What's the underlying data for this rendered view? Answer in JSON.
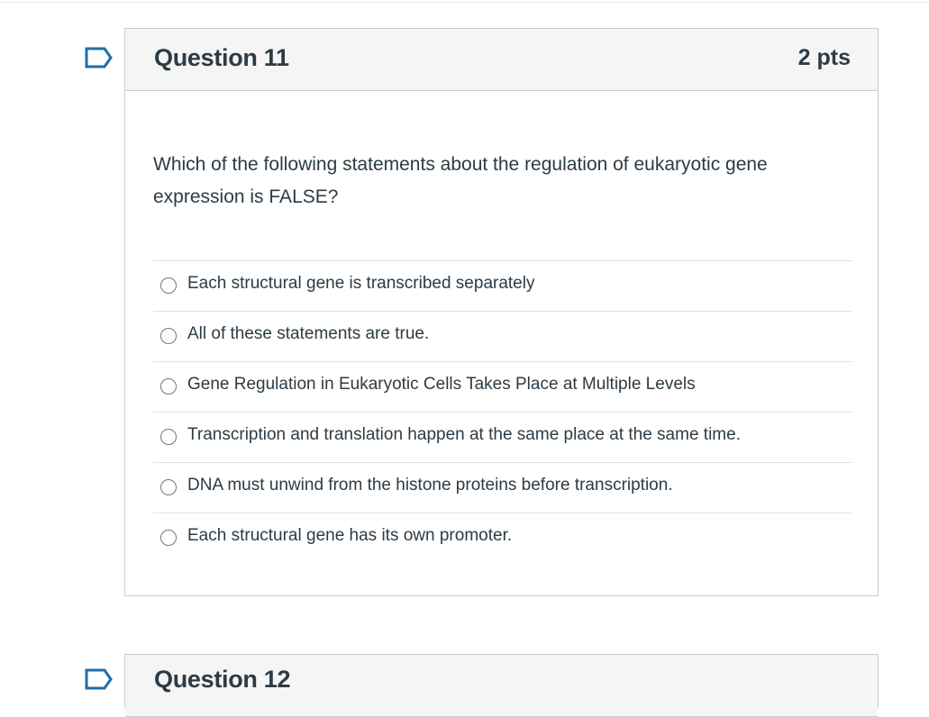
{
  "question_11": {
    "title": "Question 11",
    "points": "2 pts",
    "text": "Which of the following statements about the regulation of eukaryotic gene expression is FALSE?",
    "answers": [
      {
        "label": "Each structural gene is transcribed separately",
        "selected": false
      },
      {
        "label": "All of these statements are true.",
        "selected": false
      },
      {
        "label": "Gene Regulation in Eukaryotic Cells Takes Place at Multiple Levels",
        "selected": false
      },
      {
        "label": "Transcription and translation happen at the same place at the same time.",
        "selected": false
      },
      {
        "label": "DNA must unwind from the histone proteins before transcription.",
        "selected": false
      },
      {
        "label": "Each structural gene has its own promoter.",
        "selected": false
      }
    ]
  },
  "question_12": {
    "title": "Question 12"
  },
  "icons": {
    "flag": "flag-question-icon"
  },
  "colors": {
    "flag": "#1f6ea8",
    "text": "#2d3b45",
    "header_bg": "#f5f5f5",
    "border": "#c7cdd1"
  }
}
